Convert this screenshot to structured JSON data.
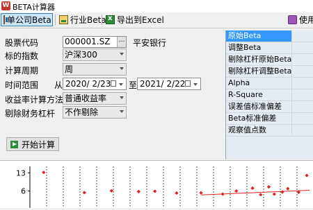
{
  "window": {
    "app_icon": "W",
    "title": "BETA计算器"
  },
  "toolbar": {
    "company_beta": "单公司Beta",
    "industry_beta": "行业Beta",
    "export_excel": "导出到Excel",
    "help": "使用"
  },
  "form": {
    "stock_code_label": "股票代码",
    "stock_code_value": "000001.SZ",
    "stock_code_button": "…",
    "stock_name": "平安银行",
    "index_label": "标的指数",
    "index_value": "沪深300",
    "period_label": "计算周期",
    "period_value": "周",
    "range_label": "时间范围",
    "from_label": "从",
    "start_date": "2020/  2/23",
    "to_label": "至",
    "end_date": "2021/  2/22",
    "return_method_label": "收益率计算方法",
    "return_method_value": "普通收益率",
    "leverage_label": "剔除财务杠杆",
    "leverage_value": "不作剔除",
    "start_button": "开始计算"
  },
  "results": {
    "items": [
      {
        "label": "原始Beta",
        "selected": true
      },
      {
        "label": "调整Beta",
        "selected": false
      },
      {
        "label": "剔除杠杆原始Beta",
        "selected": false
      },
      {
        "label": "剔除杠杆调整Beta",
        "selected": false
      },
      {
        "label": "Alpha",
        "selected": false
      },
      {
        "label": "R-Square",
        "selected": false
      },
      {
        "label": "误差值标准偏差",
        "selected": false
      },
      {
        "label": "Beta标准偏差",
        "selected": false
      },
      {
        "label": "观察值点数",
        "selected": false
      }
    ]
  },
  "chart_data": {
    "type": "scatter",
    "ytick_labels": [
      "13",
      "6"
    ],
    "ylim": [
      0,
      15
    ],
    "xlim": [
      0,
      100
    ],
    "points": [
      {
        "x": 2,
        "y": 13.2
      },
      {
        "x": 17,
        "y": 5.4
      },
      {
        "x": 27,
        "y": 6.1
      },
      {
        "x": 37,
        "y": 5.8
      },
      {
        "x": 43,
        "y": 5.9
      },
      {
        "x": 51,
        "y": 5.2
      },
      {
        "x": 60,
        "y": 5.3
      },
      {
        "x": 68,
        "y": 4.8
      },
      {
        "x": 73,
        "y": 6.0
      },
      {
        "x": 79,
        "y": 7.1
      },
      {
        "x": 82,
        "y": 4.6
      },
      {
        "x": 85,
        "y": 7.6
      },
      {
        "x": 87,
        "y": 4.8
      },
      {
        "x": 90,
        "y": 5.6
      },
      {
        "x": 92,
        "y": 6.9
      },
      {
        "x": 96,
        "y": 5.5
      },
      {
        "x": 99,
        "y": 12.0
      }
    ],
    "point_color": "#e02020",
    "trend_color": "#e02020",
    "trend_line": [
      [
        60,
        4.5
      ],
      [
        100,
        6.3
      ]
    ],
    "grid_style": "dotted vertical"
  }
}
